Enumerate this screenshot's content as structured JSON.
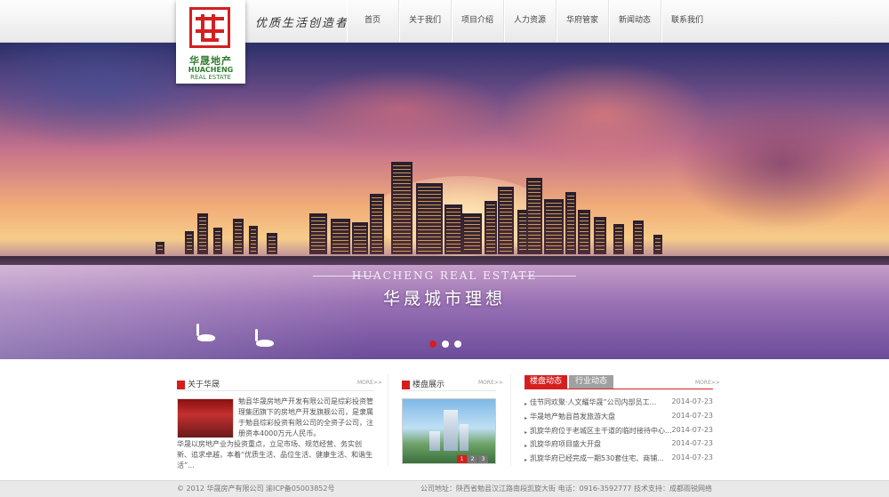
{
  "logo": {
    "cn": "华晟地产",
    "en1": "HUACHENG",
    "en2": "REAL ESTATE"
  },
  "slogan": "优质生活创造者",
  "nav": [
    "首页",
    "关于我们",
    "项目介绍",
    "人力资源",
    "华府管家",
    "新闻动态",
    "联系我们"
  ],
  "banner": {
    "en": "HUACHENG REAL ESTATE",
    "cn": "华晟城市理想",
    "slides": 3,
    "active_slide": 1
  },
  "about": {
    "title": "关于华晟",
    "more": "MORE>>",
    "text1": "勉县华晟房地产开发有限公司是综彩投资管理集团旗下的房地产开发旗舰公司，是隶属于勉县综彩投资有限公司的全资子公司，注册资本4000万元人民币。",
    "text2": "华晟以房地产业为投资重点，立足市场、规范经营、务实创新、追求卓越，本着“优质生活、品位生活、健康生活、和谐生活”..."
  },
  "showcase": {
    "title": "楼盘展示",
    "more": "MORE>>",
    "pager": [
      "1",
      "2",
      "3"
    ]
  },
  "news": {
    "tabs": [
      "楼盘动态",
      "行业动态"
    ],
    "more": "MORE>>",
    "items": [
      {
        "title": "佳节同欢聚·人文耀华晟”公司内部员工...",
        "date": "2014-07-23"
      },
      {
        "title": "华晟地产勉县首发旅游大盘",
        "date": "2014-07-23"
      },
      {
        "title": "凯旋华府位于老城区主干道的临时接待中心...",
        "date": "2014-07-23"
      },
      {
        "title": "凯旋华府项目盛大开盘",
        "date": "2014-07-23"
      },
      {
        "title": "凯旋华府已经完成一期530套住宅、商铺...",
        "date": "2014-07-23"
      }
    ]
  },
  "footer": {
    "copyright": "© 2012 华晟房产有限公司 渝ICP备05003852号",
    "contact": "公司地址：陕西省勉县汉江路南段凯旋大街  电话：0916-3592777  技术支持：成都雨锐网络"
  },
  "colors": {
    "accent": "#d51f1f",
    "tab_inactive": "#a0a0a0"
  }
}
